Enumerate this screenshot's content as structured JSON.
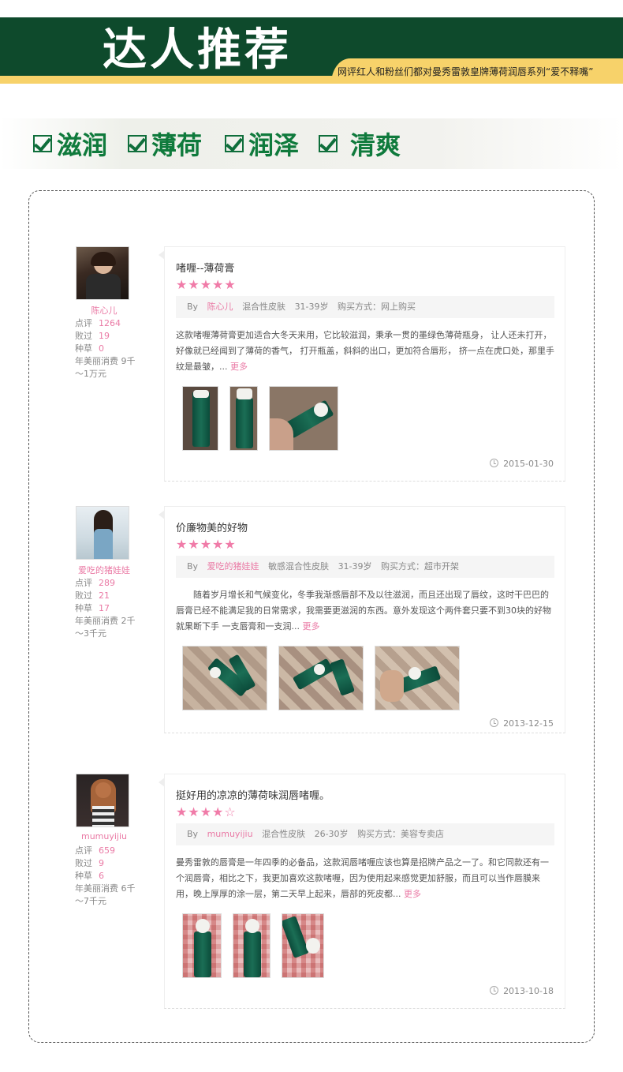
{
  "header": {
    "title": "达人推荐",
    "subtitle": "网评红人和粉丝们都对曼秀雷敦皇牌薄荷润唇系列“爱不释嘴”"
  },
  "features": [
    "滋润",
    "薄荷",
    "润泽",
    "清爽"
  ],
  "reviews": [
    {
      "user": "陈心儿",
      "stats": {
        "dianping_label": "点评",
        "dianping": "1264",
        "baiguo_label": "败过",
        "baiguo": "19",
        "zhongcao_label": "种草",
        "zhongcao": "0",
        "spend": "年美丽消费 9千～1万元"
      },
      "title": "啫喱--薄荷膏",
      "stars": "★★★★★",
      "by": "By",
      "skin": "混合性皮肤",
      "age": "31-39岁",
      "buy": "购买方式：网上购买",
      "body": "这款啫喱薄荷膏更加适合大冬天来用，它比较滋润，秉承一贯的墨绿色薄荷瓶身， 让人还未打开，好像就已经闻到了薄荷的香气， 打开瓶盖，斜斜的出口，更加符合唇形， 挤一点在虎口处，那里手纹是最皱，... ",
      "more": "更多",
      "date": "2015-01-30"
    },
    {
      "user": "爱吃的猪娃娃",
      "stats": {
        "dianping_label": "点评",
        "dianping": "289",
        "baiguo_label": "败过",
        "baiguo": "21",
        "zhongcao_label": "种草",
        "zhongcao": "17",
        "spend": "年美丽消费 2千～3千元"
      },
      "title": "价廉物美的好物",
      "stars": "★★★★★",
      "by": "By",
      "skin": "敏感混合性皮肤",
      "age": "31-39岁",
      "buy": "购买方式：超市开架",
      "body": "　　随着岁月增长和气候变化，冬季我渐感唇部不及以往滋润，而且还出现了唇纹，这时干巴巴的唇膏已经不能满足我的日常需求，我需要更滋润的东西。意外发现这个两件套只要不到30块的好物就果断下手 一支唇膏和一支润... ",
      "more": "更多",
      "date": "2013-12-15"
    },
    {
      "user": "mumuyijiu",
      "stats": {
        "dianping_label": "点评",
        "dianping": "659",
        "baiguo_label": "败过",
        "baiguo": "9",
        "zhongcao_label": "种草",
        "zhongcao": "6",
        "spend": "年美丽消费 6千～7千元"
      },
      "title": "挺好用的凉凉的薄荷味润唇啫喱。",
      "stars": "★★★★☆",
      "by": "By",
      "skin": "混合性皮肤",
      "age": "26-30岁",
      "buy": "购买方式：美容专卖店",
      "body": "曼秀雷敦的唇膏是一年四季的必备品，这款润唇啫喱应该也算是招牌产品之一了。和它同款还有一个润唇膏，相比之下，我更加喜欢这款啫喱，因为使用起来感觉更加舒服，而且可以当作唇膜来用，晚上厚厚的涂一层，第二天早上起来，唇部的死皮都... ",
      "more": "更多",
      "date": "2013-10-18"
    }
  ]
}
